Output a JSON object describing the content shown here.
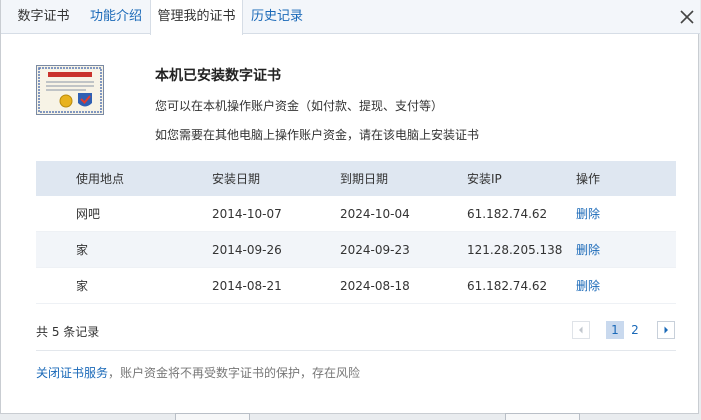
{
  "tabs": [
    {
      "label": "数字证书",
      "state": "normal"
    },
    {
      "label": "功能介绍",
      "state": "link"
    },
    {
      "label": "管理我的证书",
      "state": "active"
    },
    {
      "label": "历史记录",
      "state": "link"
    }
  ],
  "header": {
    "title": "本机已安装数字证书",
    "line1": "您可以在本机操作账户资金（如付款、提现、支付等）",
    "line2": "如您需要在其他电脑上操作账户资金，请在该电脑上安装证书"
  },
  "table": {
    "columns": [
      "使用地点",
      "安装日期",
      "到期日期",
      "安装IP",
      "操作"
    ],
    "rows": [
      {
        "location": "网吧",
        "install_date": "2014-10-07",
        "expire_date": "2024-10-04",
        "ip": "61.182.74.62",
        "action": "删除"
      },
      {
        "location": "家",
        "install_date": "2014-09-26",
        "expire_date": "2024-09-23",
        "ip": "121.28.205.138",
        "action": "删除"
      },
      {
        "location": "家",
        "install_date": "2014-08-21",
        "expire_date": "2024-08-18",
        "ip": "61.182.74.62",
        "action": "删除"
      }
    ]
  },
  "footer": {
    "record_count": "共 5 条记录",
    "pages": [
      "1",
      "2"
    ],
    "current_page": "1"
  },
  "notice": {
    "link": "关闭证书服务",
    "text": "，账户资金将不再受数字证书的保护，存在风险"
  },
  "colors": {
    "link": "#1a69b8",
    "table_header": "#dfe7f1",
    "tab_bar": "#f3f6fa"
  },
  "icons": [
    "close-icon",
    "certificate-image",
    "prev-page-icon",
    "next-page-icon"
  ]
}
